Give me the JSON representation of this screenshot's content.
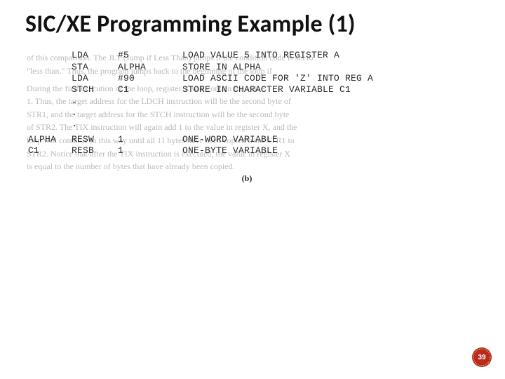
{
  "title": "SIC/XE Programming Example (1)",
  "code": {
    "rows": [
      {
        "label": "",
        "opcode": "LDA",
        "operand": "#5",
        "comment": "LOAD VALUE 5 INTO REGISTER A"
      },
      {
        "label": "",
        "opcode": "STA",
        "operand": "ALPHA",
        "comment": "STORE IN ALPHA"
      },
      {
        "label": "",
        "opcode": "LDA",
        "operand": "#90",
        "comment": "LOAD ASCII CODE FOR 'Z' INTO REG A"
      },
      {
        "label": "",
        "opcode": "STCH",
        "operand": "C1",
        "comment": "STORE IN CHARACTER VARIABLE C1"
      },
      {
        "label": "",
        "opcode": ".",
        "operand": "",
        "comment": ""
      },
      {
        "label": "",
        "opcode": ".",
        "operand": "",
        "comment": ""
      },
      {
        "label": "",
        "opcode": ".",
        "operand": "",
        "comment": ""
      },
      {
        "label": "ALPHA",
        "opcode": "RESW",
        "operand": "1",
        "comment": "ONE-WORD VARIABLE"
      },
      {
        "label": "C1",
        "opcode": "RESB",
        "operand": "1",
        "comment": "ONE-BYTE VARIABLE"
      }
    ]
  },
  "figure_label": "(b)",
  "ghost_lines": [
    "of this comparison. The JLT (Jump if Less Than) jumps if the condition code is set to",
    "\"less than.\" Thus, the program jumps back to the beginning of the loop if",
    "",
    "During the first execution of the loop, register X will contain the value",
    "1. Thus, the target address for the LDCH instruction will be the second byte of",
    "STR1, and the target address for the STCH instruction will be the second byte",
    "of STR2. The TIX instruction will again add 1 to the value in register X, and the",
    "loop will continue in this way until all 11 bytes have been copied from STR1 to",
    "STR2. Notice that after the TIX instruction is executed, the value in register X",
    "is equal to the number of bytes that have already been copied."
  ],
  "page_number": "39",
  "badge_colors": {
    "outer": "#b82b1f",
    "ring": "#e4b94a",
    "inner": "#b82b1f"
  }
}
